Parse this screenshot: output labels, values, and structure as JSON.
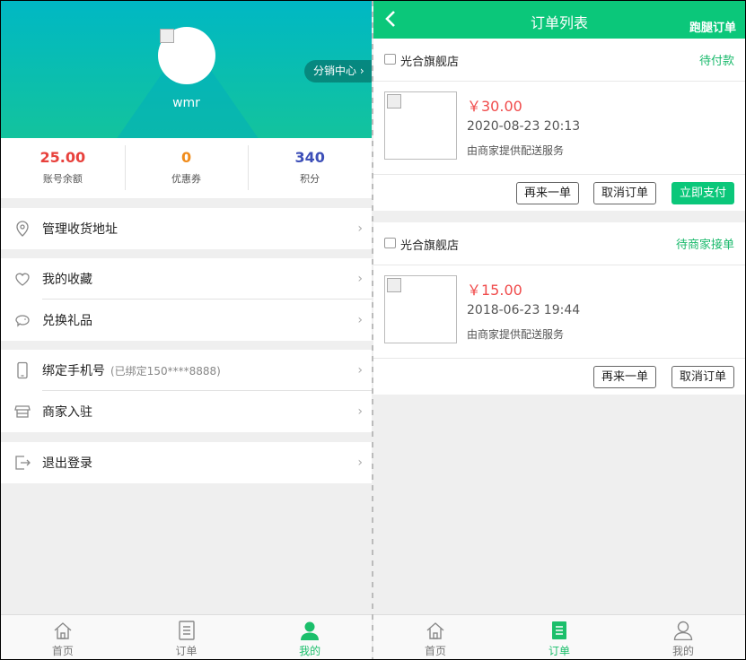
{
  "profile": {
    "username": "wmr",
    "fx_center": "分销中心 ›",
    "stats": [
      {
        "value": "25.00",
        "label": "账号余额",
        "color": "#e8413c"
      },
      {
        "value": "0",
        "label": "优惠券",
        "color": "#f08c1c"
      },
      {
        "value": "340",
        "label": "积分",
        "color": "#3d4fb8"
      }
    ],
    "menu": {
      "address": "管理收货地址",
      "favorites": "我的收藏",
      "gifts": "兑换礼品",
      "phone": "绑定手机号",
      "phone_sub": "(已绑定150****8888)",
      "merchant": "商家入驻",
      "logout": "退出登录",
      "arrow": "›"
    }
  },
  "tabs": {
    "home": "首页",
    "orders": "订单",
    "mine": "我的"
  },
  "orders_page": {
    "title": "订单列表",
    "errand": "跑腿订单",
    "orders": [
      {
        "store": "光合旗舰店",
        "status": "待付款",
        "price": "￥30.00",
        "time": "2020-08-23 20:13",
        "service": "由商家提供配送服务",
        "buttons": [
          "再来一单",
          "取消订单",
          "立即支付"
        ]
      },
      {
        "store": "光合旗舰店",
        "status": "待商家接单",
        "price": "￥15.00",
        "time": "2018-06-23 19:44",
        "service": "由商家提供配送服务",
        "buttons": [
          "再来一单",
          "取消订单"
        ]
      }
    ]
  },
  "colors": {
    "accent": "#0bc77a",
    "price": "#f04b4b"
  }
}
